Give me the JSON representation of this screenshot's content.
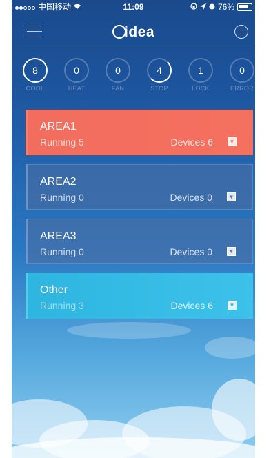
{
  "statusbar": {
    "carrier": "中国移动",
    "wifi_icon": "wifi-icon",
    "time": "11:09",
    "battery": "76%"
  },
  "header": {
    "menu_icon": "menu-icon",
    "logo": "idea",
    "clock_icon": "clock-icon"
  },
  "stats": [
    {
      "value": "8",
      "label": "COOL"
    },
    {
      "value": "0",
      "label": "HEAT"
    },
    {
      "value": "0",
      "label": "FAN"
    },
    {
      "value": "4",
      "label": "STOP"
    },
    {
      "value": "1",
      "label": "LOCK"
    },
    {
      "value": "0",
      "label": "ERROR"
    }
  ],
  "areas": [
    {
      "title": "AREA1",
      "running": "Running 5",
      "devices": "Devices 6",
      "color": "#f26d5e"
    },
    {
      "title": "AREA2",
      "running": "Running 0",
      "devices": "Devices 0",
      "color": "#4e6ea0"
    },
    {
      "title": "AREA3",
      "running": "Running 0",
      "devices": "Devices 0",
      "color": "#4e6ea0"
    },
    {
      "title": "Other",
      "running": "Running 3",
      "devices": "Devices 6",
      "color": "#2eb6e0"
    }
  ],
  "colors": {
    "accent": "#f26d5e",
    "brand_blue": "#1d56a0",
    "cyan": "#2eb6e0"
  }
}
